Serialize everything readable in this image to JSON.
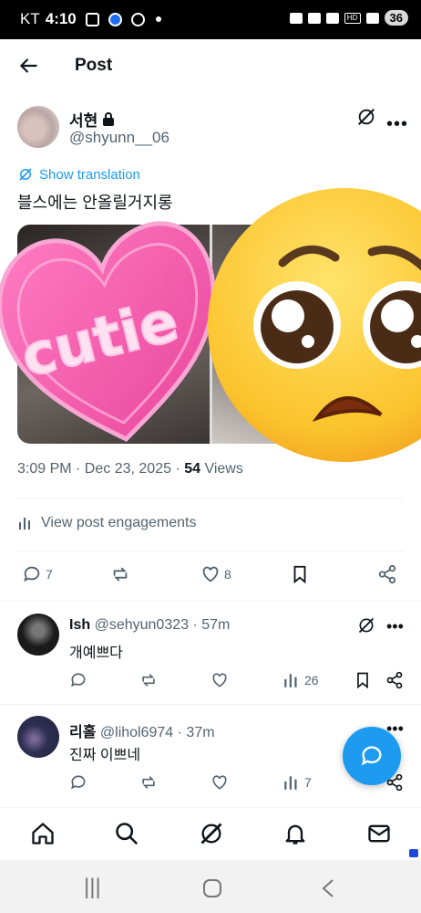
{
  "status": {
    "carrier": "KT",
    "time": "4:10",
    "battery": "36"
  },
  "header": {
    "title": "Post"
  },
  "post": {
    "author_name": "서현",
    "author_handle": "@shyunn__06",
    "translate_label": "Show translation",
    "text": "블스에는 안올릴거지롱",
    "timestamp": "3:09 PM · Dec 23, 2025 · ",
    "views_count": "54",
    "views_label": " Views",
    "engagements_label": "View post engagements",
    "replies": "7",
    "likes": "8",
    "sticker_text": "cutie"
  },
  "replies": [
    {
      "name": "Ish",
      "handle": "@sehyun0323 · 57m",
      "text": "개예쁘다",
      "views": "26",
      "avatar_color": "#1a1a1a"
    },
    {
      "name": "리홀",
      "handle": "@lihol6974 · 37m",
      "text": "진짜 이쁘네",
      "views": "7",
      "avatar_color": "#2e2f52"
    }
  ],
  "colors": {
    "accent": "#1d9bf0",
    "text": "#0f1419",
    "muted": "#536471",
    "heart": "#f25fa8"
  }
}
